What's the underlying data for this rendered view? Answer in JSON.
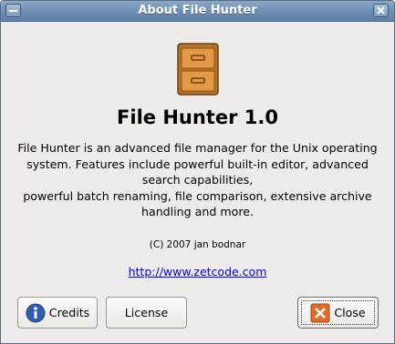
{
  "window": {
    "title": "About File Hunter"
  },
  "about": {
    "program_name": "File Hunter 1.0",
    "comments": [
      "File Hunter is an advanced file manager for the Unix operating",
      "system. Features include powerful built-in editor, advanced",
      "search capabilities,",
      "powerful batch renaming, file comparison, extensive archive",
      "handling and more."
    ],
    "copyright": "(C) 2007 jan bodnar",
    "website": "http://www.zetcode.com"
  },
  "buttons": {
    "credits_label": "Credits",
    "license_label": "License",
    "close_label": "Close"
  },
  "icons": {
    "app": "file-cabinet-icon",
    "credits": "info-icon",
    "close": "close-icon"
  },
  "colors": {
    "titlebar": "#6d8db2",
    "link": "#0000ee",
    "close_icon": "#e06a26",
    "info_icon": "#2f5fb0"
  }
}
